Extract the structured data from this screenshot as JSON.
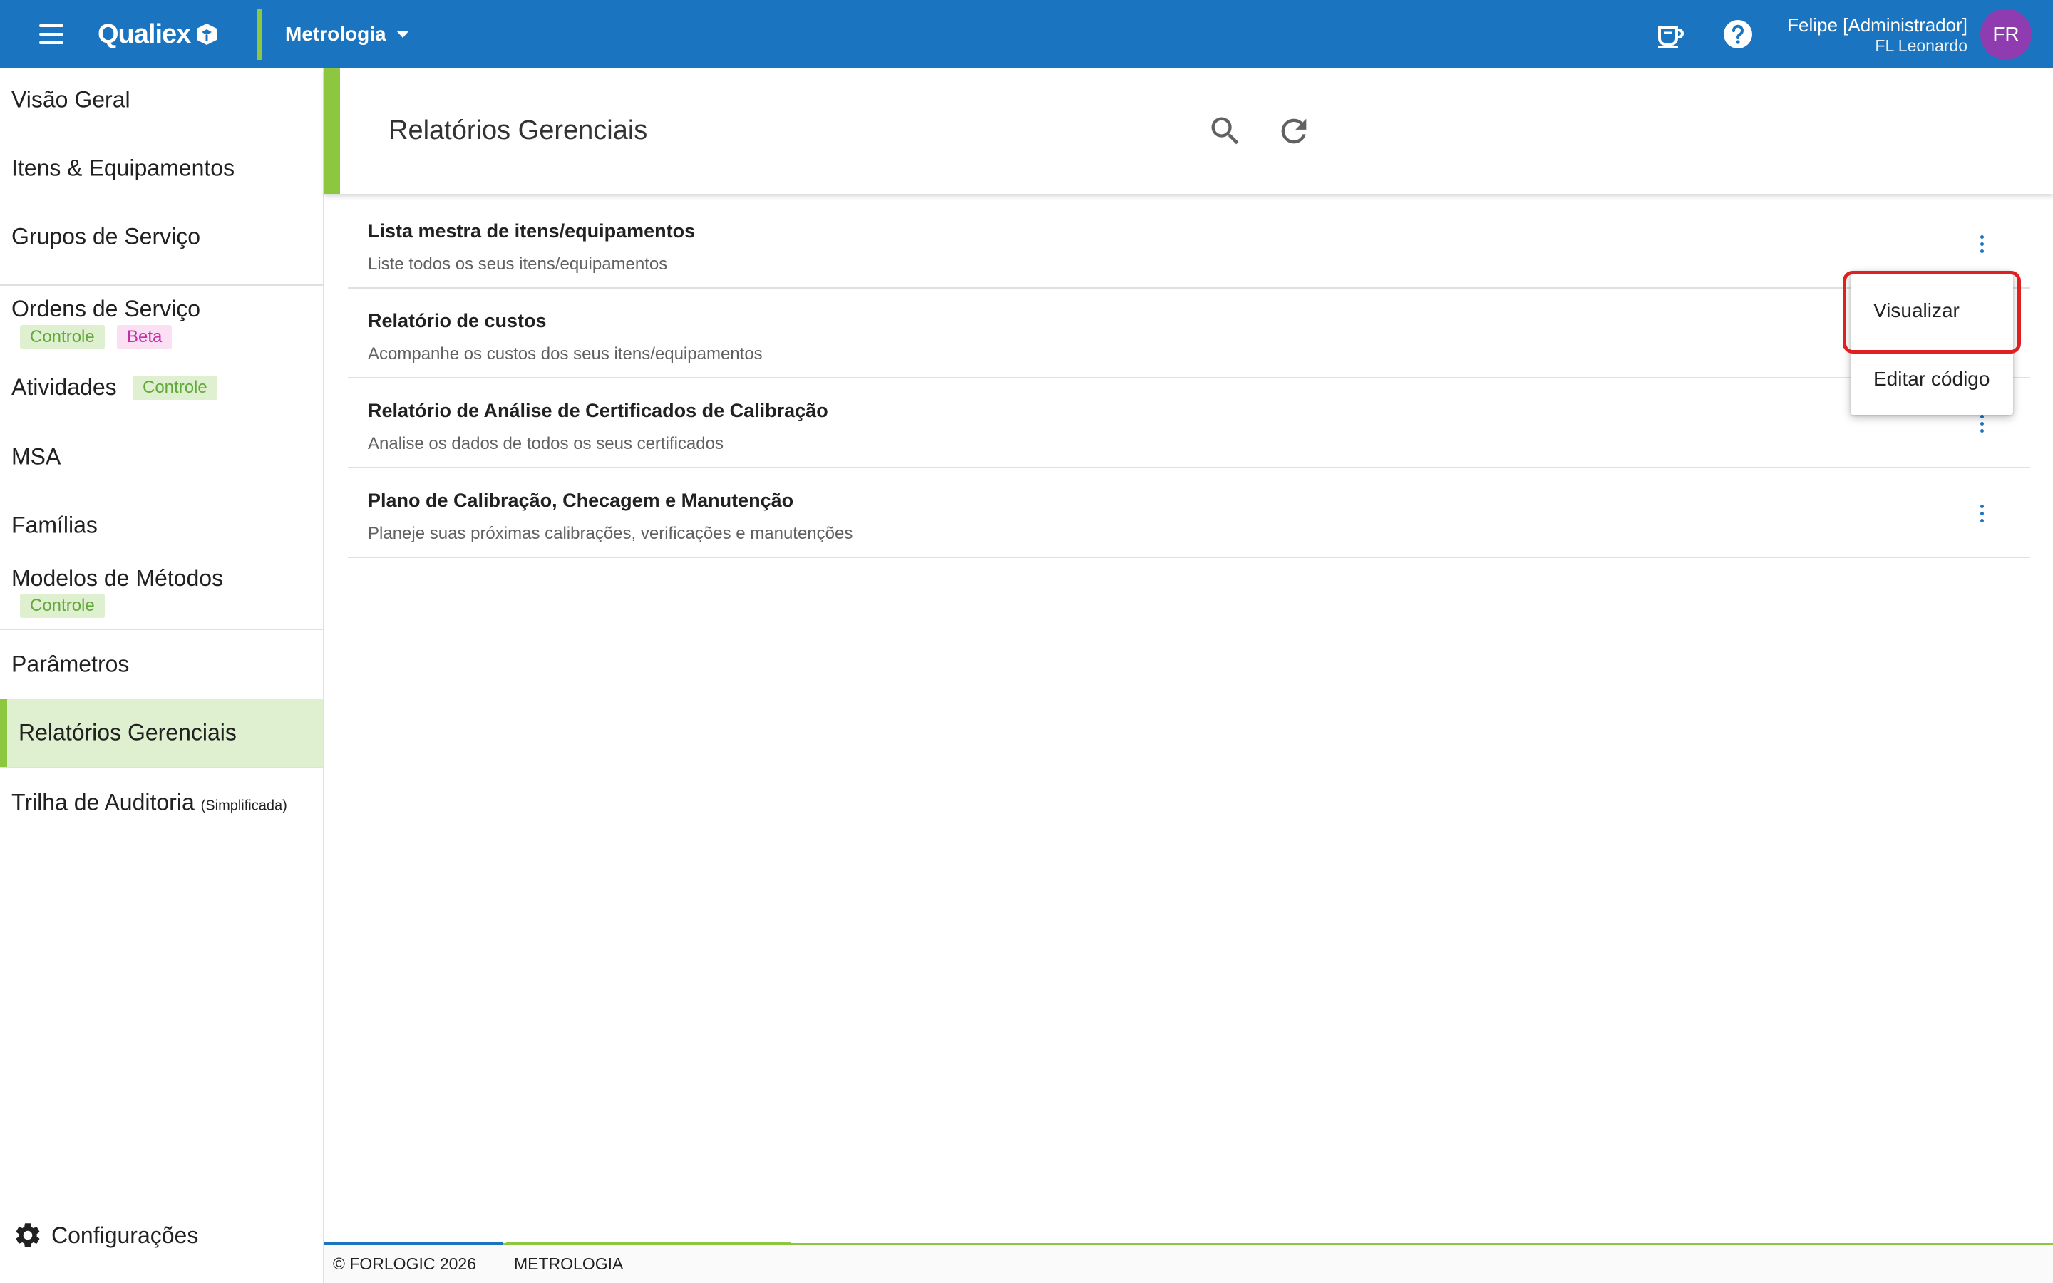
{
  "app": {
    "logo_text": "Qualiex",
    "module": "Metrologia",
    "user_name": "Felipe [Administrador]",
    "user_org": "FL Leonardo",
    "avatar_initials": "FR",
    "brand_color": "#1b74c0",
    "accent_color": "#8dc63f"
  },
  "sidebar": {
    "items": [
      {
        "label": "Visão Geral"
      },
      {
        "label": "Itens & Equipamentos"
      },
      {
        "label": "Grupos de Serviço"
      },
      {
        "label": "Ordens de Serviço",
        "badges": [
          "Controle",
          "Beta"
        ]
      },
      {
        "label": "Atividades",
        "badges": [
          "Controle"
        ]
      },
      {
        "label": "MSA"
      },
      {
        "label": "Famílias"
      },
      {
        "label": "Modelos de Métodos",
        "badges": [
          "Controle"
        ]
      },
      {
        "label": "Parâmetros"
      },
      {
        "label": "Relatórios Gerenciais",
        "active": true
      },
      {
        "label": "Trilha de Auditoria",
        "note": "(Simplificada)"
      }
    ],
    "settings_label": "Configurações"
  },
  "page": {
    "title": "Relatórios Gerenciais"
  },
  "reports": [
    {
      "title": "Lista mestra de itens/equipamentos",
      "description": "Liste todos os seus itens/equipamentos"
    },
    {
      "title": "Relatório de custos",
      "description": "Acompanhe os custos dos seus itens/equipamentos"
    },
    {
      "title": "Relatório de Análise de Certificados de Calibração",
      "description": "Analise os dados de todos os seus certificados"
    },
    {
      "title": "Plano de Calibração, Checagem e Manutenção",
      "description": "Planeje suas próximas calibrações, verificações e manutenções"
    }
  ],
  "context_menu": {
    "items": [
      "Visualizar",
      "Editar código"
    ],
    "highlighted": "Visualizar"
  },
  "footer": {
    "copyright": "© FORLOGIC 2026",
    "module": "METROLOGIA"
  }
}
